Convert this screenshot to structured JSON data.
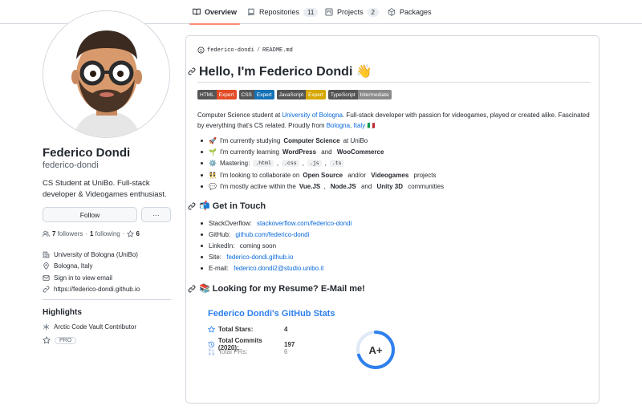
{
  "nav": {
    "tabs": [
      {
        "label": "Overview",
        "icon": "book-icon",
        "active": true
      },
      {
        "label": "Repositories",
        "count": "11",
        "icon": "repo-icon"
      },
      {
        "label": "Projects",
        "count": "2",
        "icon": "project-icon"
      },
      {
        "label": "Packages",
        "icon": "package-icon"
      }
    ]
  },
  "profile": {
    "name": "Federico Dondi",
    "login": "federico-dondi",
    "bio": "CS Student at UniBo. Full-stack developer & Videogames enthusiast.",
    "follow_label": "Follow",
    "more_label": "···",
    "followers_count": "7",
    "followers_label": "followers",
    "following_count": "1",
    "following_label": "following",
    "stars_count": "6",
    "organization": "University of Bologna (UniBo)",
    "location": "Bologna, Italy",
    "email": "Sign in to view email",
    "website": "https://federico-dondi.github.io"
  },
  "highlights": {
    "title": "Highlights",
    "items": [
      {
        "label": "Arctic Code Vault Contributor",
        "icon": "arctic-vault-icon"
      },
      {
        "label": "PRO",
        "icon": "star-icon"
      }
    ]
  },
  "readme": {
    "path_user": "federico-dondi",
    "path_sep": "/",
    "path_file": "README.md",
    "title": "Hello, I'm Federico Dondi 👋",
    "badges": [
      {
        "label": "HTML",
        "value": "Expert",
        "color": "#e34c26"
      },
      {
        "label": "CSS",
        "value": "Expert",
        "color": "#1572b6"
      },
      {
        "label": "JavaScript",
        "value": "Expert",
        "color": "#d6a700"
      },
      {
        "label": "TypeScript",
        "value": "Intermediate",
        "color": "#8a8a8a"
      }
    ],
    "intro_1": "Computer Science student at ",
    "intro_link_1": "University of Bologna",
    "intro_2": ". Full-stack developer with passion for videogames, played or created alike. Fascinated by everything that's CS related. Proudly from ",
    "intro_link_2": "Bologna, Italy",
    "intro_flag": "🇮🇹",
    "bullets": {
      "b1_emoji": "🚀",
      "b1_pre": "I'm currently studying ",
      "b1_bold": "Computer Science",
      "b1_post": " at UniBo",
      "b2_emoji": "🌱",
      "b2_pre": "I'm currently learning ",
      "b2_bold1": "WordPress",
      "b2_mid": " and ",
      "b2_bold2": "WooCommerce",
      "b3_emoji": "⚙️",
      "b3_pre": "Mastering: ",
      "b3_c1": ".html",
      "b3_c2": ".css",
      "b3_c3": ".js",
      "b3_c4": ".ts",
      "b3_sep": ",",
      "b4_emoji": "👯",
      "b4_pre": "I'm looking to collaborate on ",
      "b4_bold1": "Open Source",
      "b4_mid": " and/or ",
      "b4_bold2": "Videogames",
      "b4_post": " projects",
      "b5_emoji": "💬",
      "b5_pre": "I'm mostly active within the ",
      "b5_bold1": "Vue.JS",
      "b5_sep": ", ",
      "b5_bold2": "Node.JS",
      "b5_mid": " and ",
      "b5_bold3": "Unity 3D",
      "b5_post": " communities"
    },
    "contact_title": "📬 Get in Touch",
    "contacts": [
      {
        "key": "StackOverflow: ",
        "value": "stackoverflow.com/federico-dondi",
        "link": true
      },
      {
        "key": "GitHub: ",
        "value": "github.com/federico-dondi",
        "link": true
      },
      {
        "key": "LinkedIn: ",
        "value": "coming soon",
        "link": false
      },
      {
        "key": "Site: ",
        "value": "federico-dondi.github.io",
        "link": true
      },
      {
        "key": "E-mail: ",
        "value": "federico.dondi2@studio.unibo.it",
        "link": true
      }
    ],
    "resume_title": "📚 Looking for my Resume? E-Mail me!"
  },
  "stats_card": {
    "title": "Federico Dondi's GitHub Stats",
    "rows": [
      {
        "label": "Total Stars:",
        "value": "4",
        "icon": "star-icon"
      },
      {
        "label": "Total Commits (2020):",
        "value": "197",
        "icon": "history-icon"
      },
      {
        "label": "Total PRs:",
        "value": "6",
        "icon": "pull-request-icon"
      }
    ],
    "grade": "A+",
    "ring_color": "#2f80ed",
    "ring_fill": 0.7
  }
}
